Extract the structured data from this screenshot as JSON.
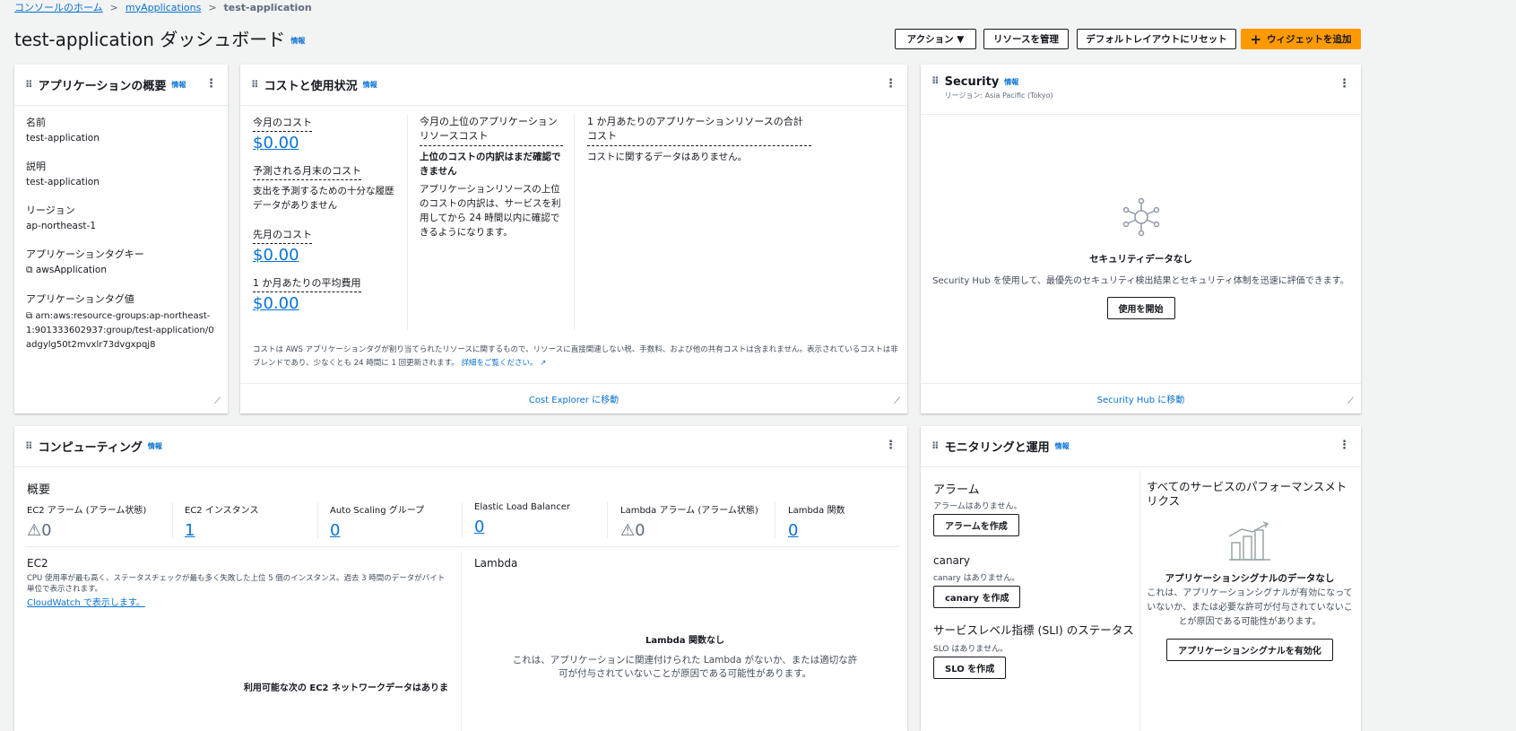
{
  "breadcrumb": {
    "home": "コンソールのホーム",
    "apps": "myApplications",
    "current": "test-application"
  },
  "page": {
    "title": "test-application ダッシュボード",
    "info": "情報"
  },
  "actions": {
    "action": "アクション ▼",
    "manage": "リソースを管理",
    "reset": "デフォルトレイアウトにリセット",
    "add": "ウィジェットを追加",
    "add_icon": "+"
  },
  "overview": {
    "title": "アプリケーションの概要",
    "info": "情報",
    "fields": [
      {
        "label": "名前",
        "value": "test-application"
      },
      {
        "label": "説明",
        "value": "test-application"
      },
      {
        "label": "リージョン",
        "value": "ap-northeast-1"
      },
      {
        "label": "アプリケーションタグキー",
        "value": "awsApplication"
      },
      {
        "label": "アプリケーションタグ値",
        "value": "arn:aws:resource-groups:ap-northeast-1:901333602937:group/test-application/0adgylg50t2mvxlr73dvgxpqj8"
      }
    ]
  },
  "cost": {
    "title": "コストと使用状況",
    "info": "情報",
    "this_month_label": "今月のコスト",
    "this_month": "$0.00",
    "forecast_label": "予測される月末のコスト",
    "forecast_text": "支出を予測するための十分な履歴データがありません",
    "last_month_label": "先月のコスト",
    "last_month": "$0.00",
    "avg_label": "1 か月あたりの平均費用",
    "avg": "$0.00",
    "top_label": "今月の上位のアプリケーションリソースコスト",
    "top_bold": "上位のコストの内訳はまだ確認できません",
    "top_text": "アプリケーションリソースの上位のコストの内訳は、サービスを利用してから 24 時間以内に確認できるようになります。",
    "total_label": "1 か月あたりのアプリケーションリソースの合計コスト",
    "total_text": "コストに関するデータはありません。",
    "note": "コストは AWS アプリケーションタグが割り当てられたリソースに関するもので、リソースに直接関連しない税、手数料、および他の共有コストは含まれません。表示されているコストは非ブレンドであり、少なくとも 24 時間に 1 回更新されます。",
    "note_link": "詳細をご覧ください。",
    "footer": "Cost Explorer に移動"
  },
  "security": {
    "title": "Security",
    "info": "情報",
    "region": "リージョン: Asia Pacific (Tokyo)",
    "empty_title": "セキュリティデータなし",
    "empty_text": "Security Hub を使用して、最優先のセキュリティ検出結果とセキュリティ体制を迅速に評価できます。",
    "start": "使用を開始",
    "footer": "Security Hub に移動"
  },
  "compute": {
    "title": "コンピューティング",
    "info": "情報",
    "summary": "概要",
    "metrics": [
      {
        "label": "EC2 アラーム (アラーム状態)",
        "value": "0",
        "warn": true
      },
      {
        "label": "EC2 インスタンス",
        "value": "1"
      },
      {
        "label": "Auto Scaling グループ",
        "value": "0"
      },
      {
        "label": "Elastic Load Balancer",
        "value": "0"
      },
      {
        "label": "Lambda アラーム (アラーム状態)",
        "value": "0",
        "warn": true
      },
      {
        "label": "Lambda 関数",
        "value": "0"
      }
    ],
    "ec2_title": "EC2",
    "ec2_text": "CPU 使用率が最も高く、ステータスチェックが最も多く失敗した上位 5 個のインスタンス。過去 3 時間のデータがバイト単位で表示されます。",
    "ec2_link": "CloudWatch で表示します。",
    "ec2_empty": "利用可能な次の EC2 ネットワークデータはありま",
    "lambda_title": "Lambda",
    "lambda_empty": "Lambda 関数なし",
    "lambda_text": "これは、アプリケーションに関連付けられた Lambda がないか、または適切な許可が付与されていないことが原因である可能性があります。"
  },
  "monitoring": {
    "title": "モニタリングと運用",
    "info": "情報",
    "alarm_title": "アラーム",
    "alarm_text": "アラームはありません。",
    "alarm_btn": "アラームを作成",
    "canary_title": "canary",
    "canary_text": "canary はありません。",
    "canary_btn": "canary を作成",
    "sli_title": "サービスレベル指標 (SLI) のステータス",
    "slo_text": "SLO はありません。",
    "slo_btn": "SLO を作成",
    "perf_title": "すべてのサービスのパフォーマンスメトリクス",
    "signal_title": "アプリケーションシグナルのデータなし",
    "signal_text": "これは、アプリケーションシグナルが有効になっていないか、または必要な許可が付与されていないことが原因である可能性があります。",
    "signal_btn": "アプリケーションシグナルを有効化"
  }
}
